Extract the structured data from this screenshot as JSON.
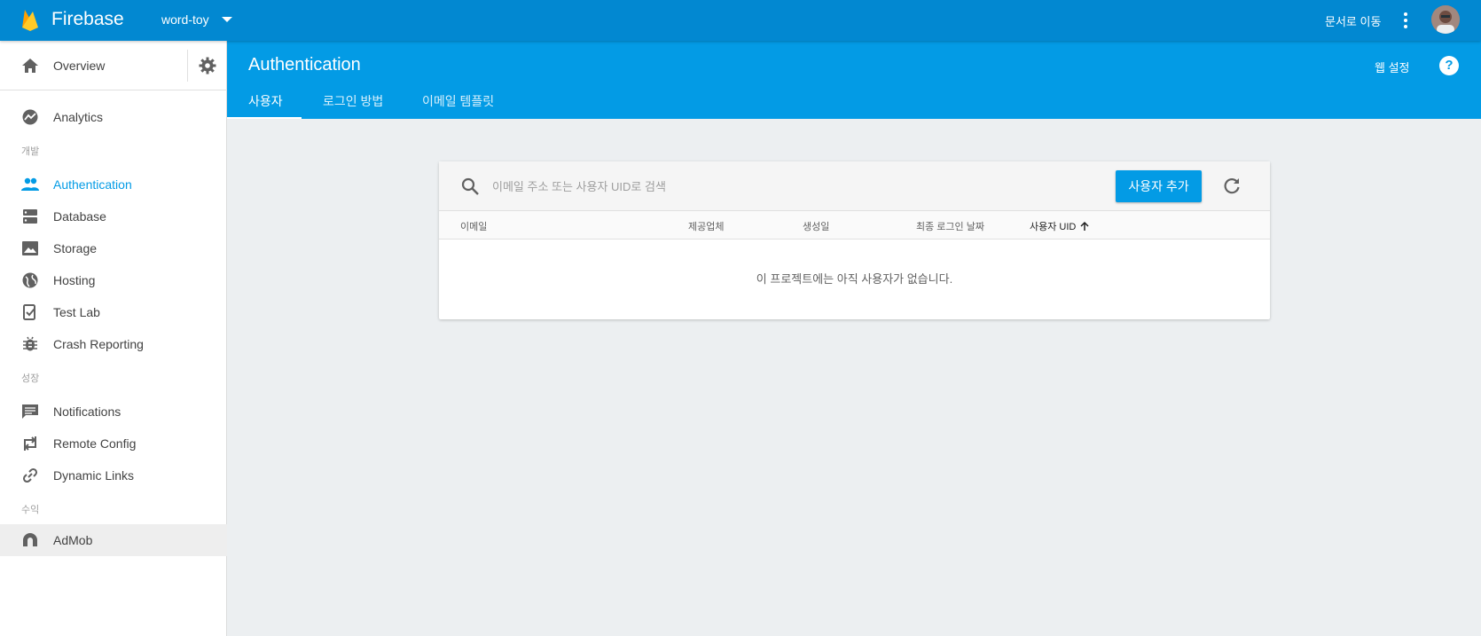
{
  "topbar": {
    "brand": "Firebase",
    "project": "word-toy",
    "docs_link": "문서로 이동"
  },
  "sidebar": {
    "overview": "Overview",
    "analytics": "Analytics",
    "sections": {
      "develop": "개발",
      "grow": "성장",
      "earn": "수익"
    },
    "develop_items": [
      {
        "label": "Authentication",
        "icon": "people-icon"
      },
      {
        "label": "Database",
        "icon": "database-icon"
      },
      {
        "label": "Storage",
        "icon": "image-icon"
      },
      {
        "label": "Hosting",
        "icon": "globe-icon"
      },
      {
        "label": "Test Lab",
        "icon": "test-lab-icon"
      },
      {
        "label": "Crash Reporting",
        "icon": "bug-icon"
      }
    ],
    "grow_items": [
      {
        "label": "Notifications",
        "icon": "message-icon"
      },
      {
        "label": "Remote Config",
        "icon": "remote-config-icon"
      },
      {
        "label": "Dynamic Links",
        "icon": "link-icon"
      }
    ],
    "earn_items": [
      {
        "label": "AdMob",
        "icon": "admob-icon"
      }
    ]
  },
  "header": {
    "title": "Authentication",
    "web_setup": "웹 설정",
    "help": "?",
    "tabs": [
      {
        "label": "사용자"
      },
      {
        "label": "로그인 방법"
      },
      {
        "label": "이메일 템플릿"
      }
    ]
  },
  "users": {
    "search_placeholder": "이메일 주소 또는 사용자 UID로 검색",
    "add_user": "사용자 추가",
    "columns": [
      "이메일",
      "제공업체",
      "생성일",
      "최종 로그인 날짜",
      "사용자 UID"
    ],
    "sorted_column": "사용자 UID",
    "sort_direction": "ascending",
    "empty_message": "이 프로젝트에는 아직 사용자가 없습니다."
  },
  "colors": {
    "topbar": "#0288d1",
    "header": "#039be5",
    "accent": "#039be5",
    "background": "#eceff1"
  }
}
